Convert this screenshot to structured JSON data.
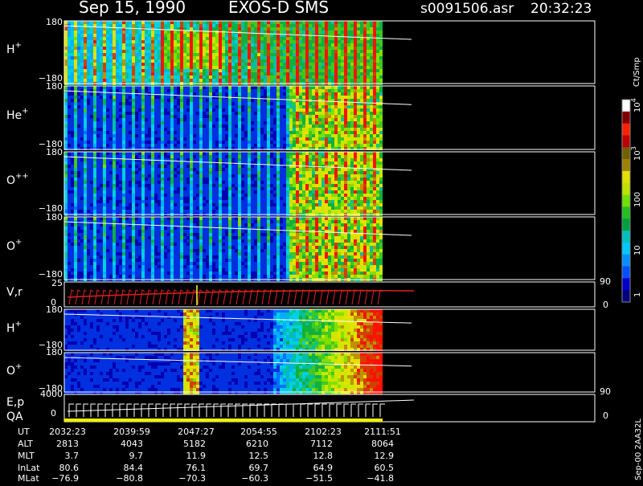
{
  "header": {
    "date": "Sep 15, 1990",
    "instrument": "EXOS-D SMS",
    "file": "s0091506.asr",
    "time": "20:32:23"
  },
  "colorbar": {
    "unit_label": "Ct/Smp",
    "tick_labels": [
      "1",
      "10",
      "100",
      "10",
      "10"
    ],
    "tick_exponents": [
      "",
      "",
      "",
      "3",
      "4"
    ],
    "colors": [
      "#000080",
      "#0000c8",
      "#0050ff",
      "#0090ff",
      "#00c8ff",
      "#00c0c0",
      "#00a040",
      "#20c020",
      "#70e000",
      "#c0e000",
      "#e0e000",
      "#a08000",
      "#706000",
      "#c00000",
      "#ff2000",
      "#800000",
      "#ffffff"
    ]
  },
  "side_labels": {
    "stamp": "Sep-00 2AA32L"
  },
  "chart_data": {
    "type": "heatmap",
    "panels": [
      {
        "label": "H",
        "superscript": "+",
        "ymax": "180",
        "ymin": "−180"
      },
      {
        "label": "He",
        "superscript": "+",
        "ymax": "180",
        "ymin": "−180"
      },
      {
        "label": "O",
        "superscript": "++",
        "ymax": "180",
        "ymin": "−180"
      },
      {
        "label": "O",
        "superscript": "+",
        "ymax": "180",
        "ymin": "−180"
      },
      {
        "label": "V,r",
        "superscript": "",
        "ymax": "25",
        "ymin": "0",
        "right_max": "90",
        "right_min": "0"
      },
      {
        "label": "H",
        "superscript": "+",
        "ymax": "180",
        "ymin": "−180"
      },
      {
        "label": "O",
        "superscript": "+",
        "ymax": "180",
        "ymin": "−180"
      },
      {
        "label": "E,p",
        "superscript": "",
        "label2": "QA",
        "ymax": "4000",
        "ymin": "0",
        "right_max": "90",
        "right_min": "0"
      }
    ],
    "footer": {
      "rows": [
        {
          "name": "UT",
          "values": [
            "2032:23",
            "2039:59",
            "2047:27",
            "2054:55",
            "2102:23",
            "2111:51"
          ]
        },
        {
          "name": "ALT",
          "values": [
            "2813",
            "4043",
            "5182",
            "6210",
            "7112",
            "8064"
          ]
        },
        {
          "name": "MLT",
          "values": [
            "3.7",
            "9.7",
            "11.9",
            "12.5",
            "12.8",
            "12.9"
          ]
        },
        {
          "name": "InLat",
          "values": [
            "80.6",
            "84.4",
            "76.1",
            "69.7",
            "64.9",
            "60.5"
          ]
        },
        {
          "name": "MLat",
          "values": [
            "−76.9",
            "−80.8",
            "−70.3",
            "−60.3",
            "−51.5",
            "−41.8"
          ]
        }
      ]
    }
  }
}
